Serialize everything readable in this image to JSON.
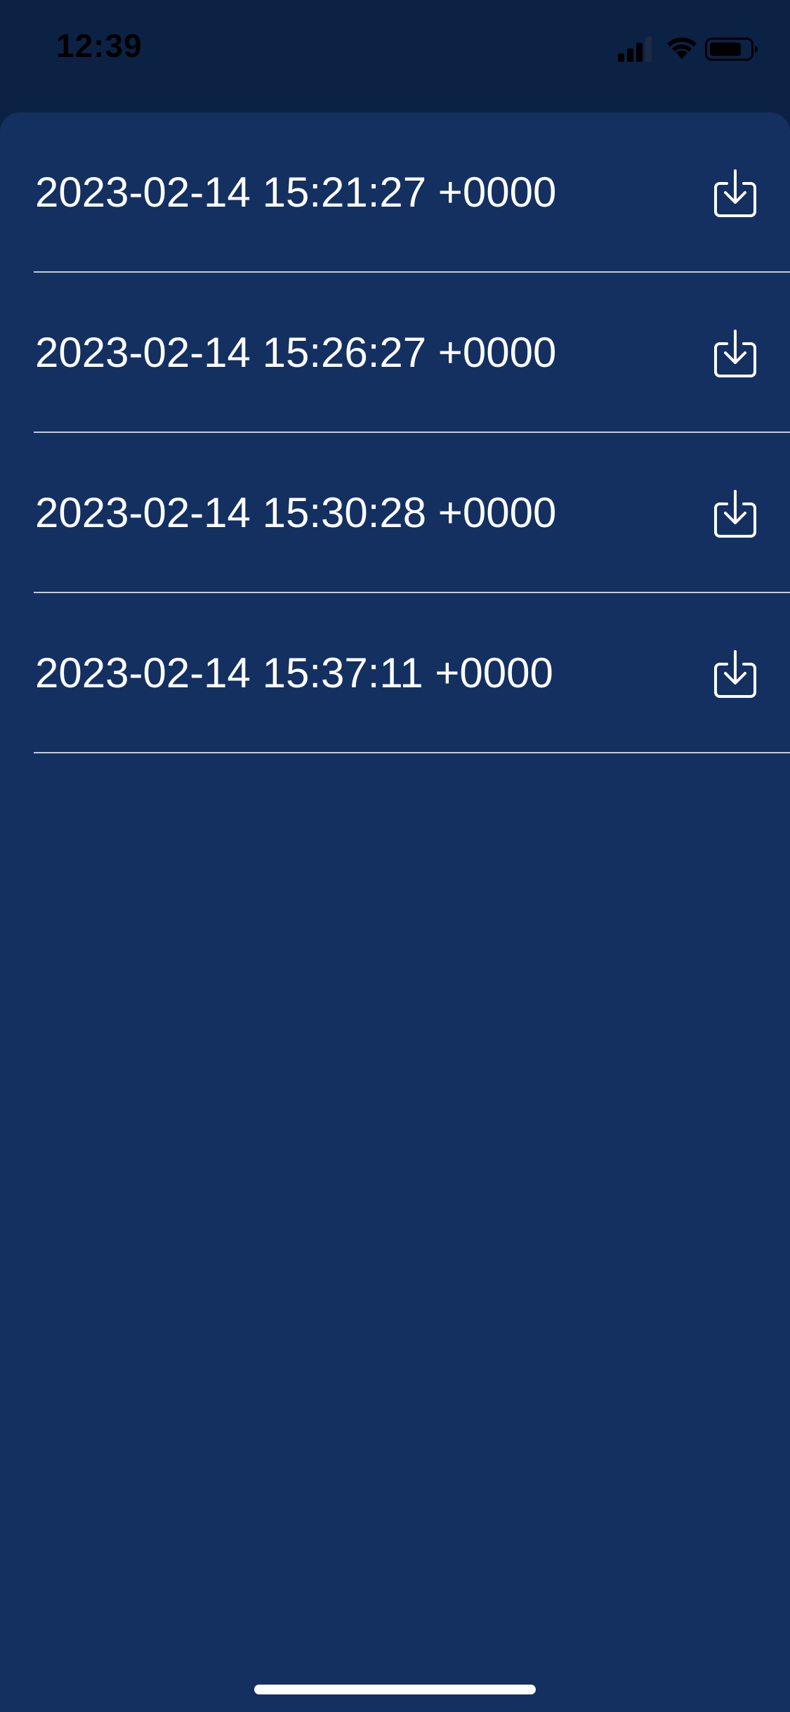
{
  "status_bar": {
    "time": "12:39",
    "icons": [
      "cellular-signal-icon",
      "wifi-icon",
      "battery-icon"
    ]
  },
  "list": {
    "items": [
      {
        "label": "2023-02-14 15:21:27 +0000",
        "action_icon": "download-icon"
      },
      {
        "label": "2023-02-14 15:26:27 +0000",
        "action_icon": "download-icon"
      },
      {
        "label": "2023-02-14 15:30:28 +0000",
        "action_icon": "download-icon"
      },
      {
        "label": "2023-02-14 15:37:11 +0000",
        "action_icon": "download-icon"
      }
    ]
  },
  "colors": {
    "background": "#0c2245",
    "sheet": "#133061",
    "text": "#ffffff"
  }
}
